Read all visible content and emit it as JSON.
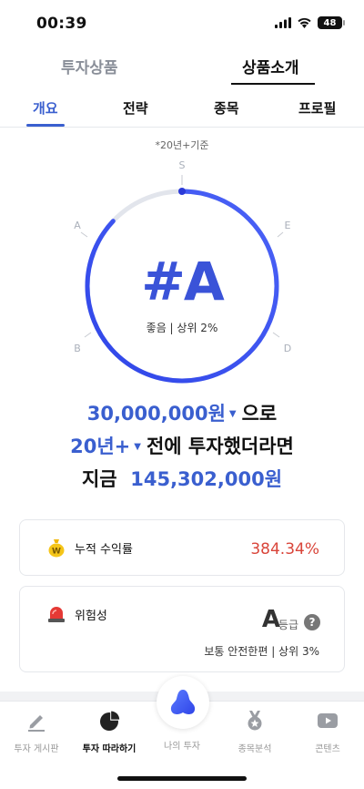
{
  "status_bar": {
    "time": "00:39",
    "battery": "48"
  },
  "top_tabs": [
    {
      "label": "투자상품",
      "active": false
    },
    {
      "label": "상품소개",
      "active": true
    }
  ],
  "sub_tabs": [
    {
      "label": "개요",
      "active": true
    },
    {
      "label": "전략",
      "active": false
    },
    {
      "label": "종목",
      "active": false
    },
    {
      "label": "프로필",
      "active": false
    }
  ],
  "gauge": {
    "basis_note": "*20년+기준",
    "grade": "#A",
    "description": "좋음 | 상위 2%",
    "marks": [
      "S",
      "E",
      "D",
      "B",
      "A"
    ],
    "fill_fraction": 0.87,
    "colors": {
      "track": "#e2e5ec",
      "start": "#2f45e8",
      "end": "#4b63f7"
    }
  },
  "sentence": {
    "amount": "30,000,000원",
    "suffix1": "으로",
    "period": "20년+",
    "suffix2": "전에 투자했더라면",
    "prefix3": "지금",
    "result": "145,302,000원"
  },
  "cards": {
    "return": {
      "label": "누적 수익률",
      "value": "384.34%",
      "icon": "money-bag-icon"
    },
    "risk": {
      "label": "위험성",
      "grade": "A",
      "grade_unit": "등급",
      "help": "?",
      "description": "보통 안전한편 | 상위 3%",
      "icon": "siren-icon"
    }
  },
  "bottom_nav": [
    {
      "label": "투자 게시판",
      "icon": "pencil-icon",
      "active": false
    },
    {
      "label": "투자 따라하기",
      "icon": "pie-chart-icon",
      "active": true
    },
    {
      "label": "나의 투자",
      "icon": "blob-logo-icon",
      "active": false
    },
    {
      "label": "종목분석",
      "icon": "medal-icon",
      "active": false
    },
    {
      "label": "콘텐츠",
      "icon": "play-icon",
      "active": false
    }
  ],
  "colors": {
    "accent": "#3a5fcf",
    "negative_red": "#d9453a"
  }
}
